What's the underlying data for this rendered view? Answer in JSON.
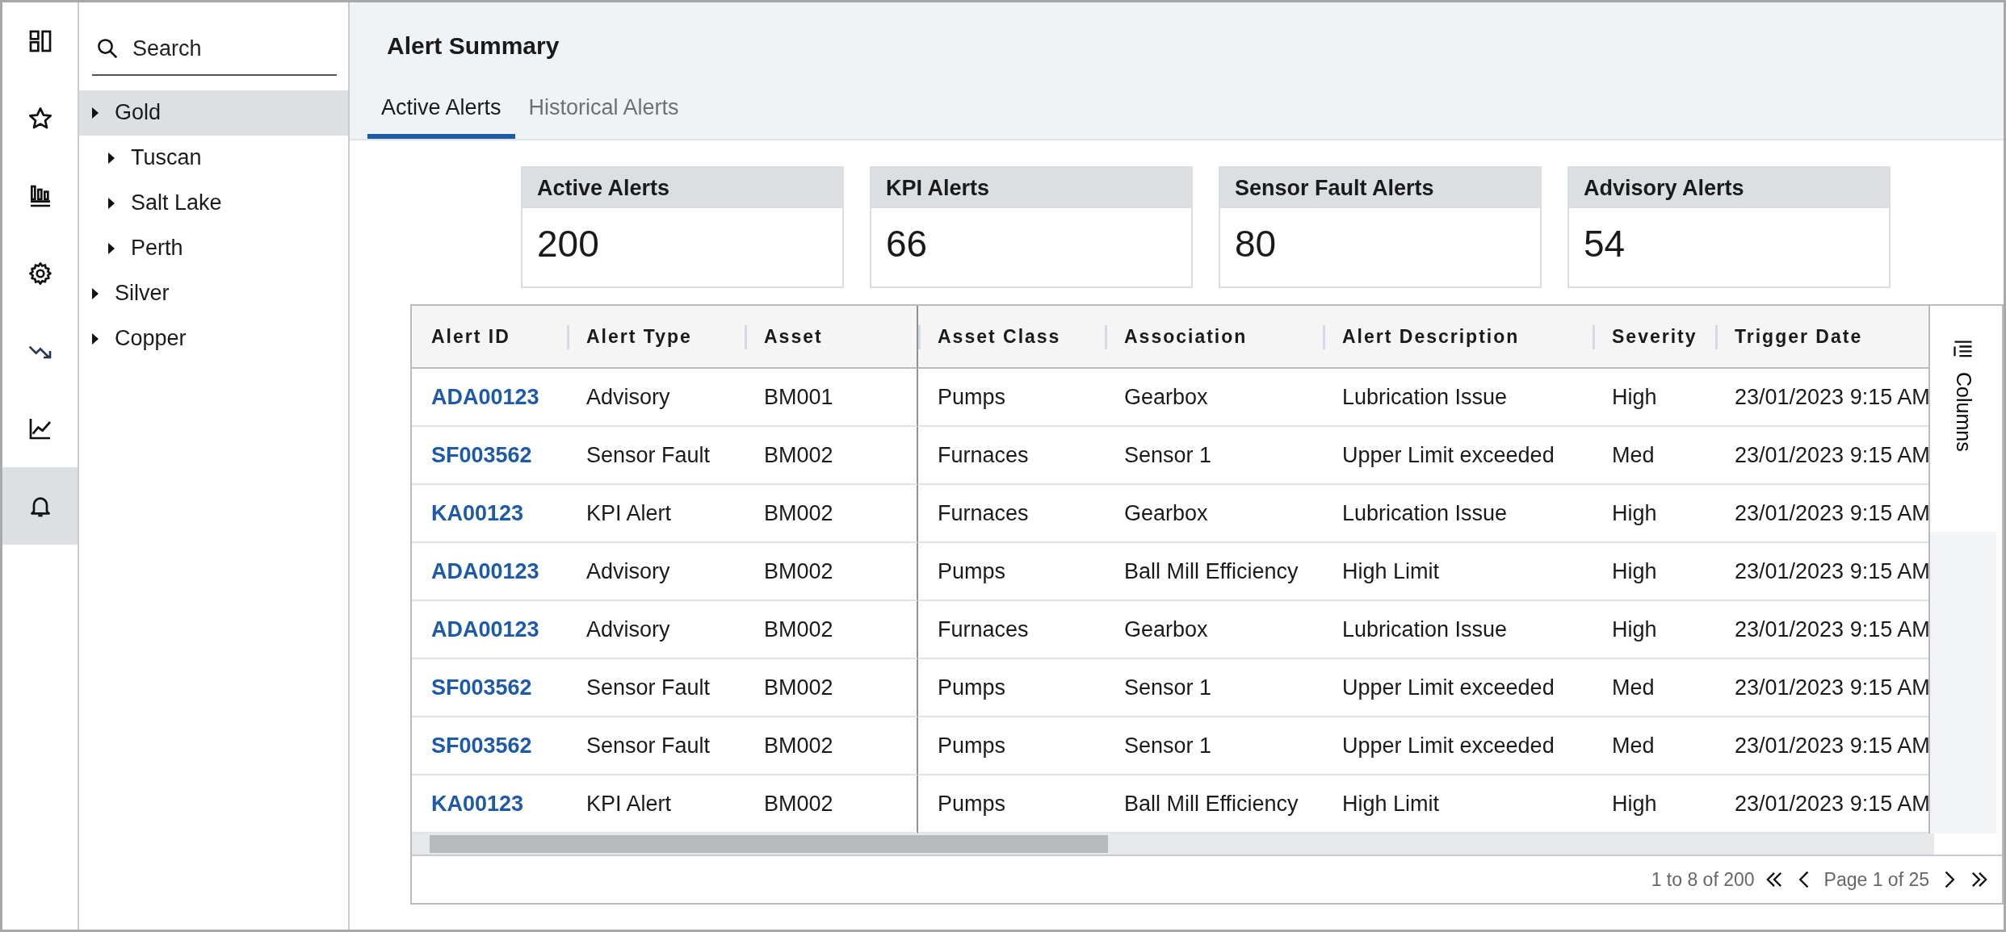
{
  "rail": [
    {
      "selected": false
    },
    {
      "selected": false
    },
    {
      "selected": false
    },
    {
      "selected": false
    },
    {
      "selected": false
    },
    {
      "selected": false
    },
    {
      "selected": true
    }
  ],
  "tree": {
    "search": {
      "placeholder": "Search"
    },
    "items": [
      {
        "label": "Gold",
        "selected": true,
        "children": [
          {
            "label": "Tuscan",
            "selected": false
          },
          {
            "label": "Salt Lake",
            "selected": false
          },
          {
            "label": "Perth",
            "selected": false
          }
        ]
      },
      {
        "label": "Silver",
        "selected": false
      },
      {
        "label": "Copper",
        "selected": false
      }
    ]
  },
  "header": {
    "title": "Alert Summary"
  },
  "tabs": [
    {
      "label": "Active Alerts",
      "selected": true
    },
    {
      "label": "Historical Alerts",
      "selected": false
    }
  ],
  "cards": [
    {
      "title": "Active Alerts",
      "value": "200"
    },
    {
      "title": "KPI Alerts",
      "value": "66"
    },
    {
      "title": "Sensor Fault Alerts",
      "value": "80"
    },
    {
      "title": "Advisory Alerts",
      "value": "54"
    }
  ],
  "table": {
    "columns": [
      {
        "label": "Alert ID",
        "pinned": true
      },
      {
        "label": "Alert Type",
        "pinned": true
      },
      {
        "label": "Asset",
        "pinned": true
      },
      {
        "label": "Asset Class",
        "pinned": false
      },
      {
        "label": "Association",
        "pinned": false
      },
      {
        "label": "Alert Description",
        "pinned": false
      },
      {
        "label": "Severity",
        "pinned": false
      },
      {
        "label": "Trigger Date",
        "pinned": false
      }
    ],
    "rows": [
      [
        "ADA00123",
        "Advisory",
        "BM001",
        "Pumps",
        "Gearbox",
        "Lubrication Issue",
        "High",
        "23/01/2023 9:15 AM"
      ],
      [
        "SF003562",
        "Sensor Fault",
        "BM002",
        "Furnaces",
        "Sensor 1",
        "Upper Limit exceeded",
        "Med",
        "23/01/2023 9:15 AM"
      ],
      [
        "KA00123",
        "KPI Alert",
        "BM002",
        "Furnaces",
        "Gearbox",
        "Lubrication Issue",
        "High",
        "23/01/2023 9:15 AM"
      ],
      [
        "ADA00123",
        "Advisory",
        "BM002",
        "Pumps",
        "Ball Mill Efficiency",
        "High Limit",
        "High",
        "23/01/2023 9:15 AM"
      ],
      [
        "ADA00123",
        "Advisory",
        "BM002",
        "Furnaces",
        "Gearbox",
        "Lubrication Issue",
        "High",
        "23/01/2023 9:15 AM"
      ],
      [
        "SF003562",
        "Sensor Fault",
        "BM002",
        "Pumps",
        "Sensor 1",
        "Upper Limit exceeded",
        "Med",
        "23/01/2023 9:15 AM"
      ],
      [
        "SF003562",
        "Sensor Fault",
        "BM002",
        "Pumps",
        "Sensor 1",
        "Upper Limit exceeded",
        "Med",
        "23/01/2023 9:15 AM"
      ],
      [
        "KA00123",
        "KPI Alert",
        "BM002",
        "Pumps",
        "Ball Mill Efficiency",
        "High Limit",
        "High",
        "23/01/2023 9:15 AM"
      ]
    ],
    "side_panel": {
      "label": "Columns"
    },
    "pager": {
      "summary": "1 to 8 of 200",
      "page": "Page 1 of 25"
    }
  }
}
